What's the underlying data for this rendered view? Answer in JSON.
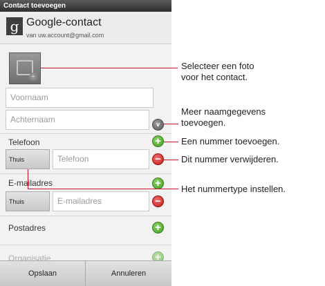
{
  "titlebar": {
    "title": "Contact toevoegen"
  },
  "account": {
    "logo": "g",
    "name": "Google-contact",
    "email": "van uw.account@gmail.com"
  },
  "photo": {
    "icon": "add-photo-icon",
    "plus": "+"
  },
  "name": {
    "first_placeholder": "Voornaam",
    "last_placeholder": "Achternaam",
    "more_icon": "v"
  },
  "phone": {
    "label": "Telefoon",
    "type": "Thuis",
    "placeholder": "Telefoon"
  },
  "email": {
    "label": "E-mailadres",
    "type": "Thuis",
    "placeholder": "E-mailadres"
  },
  "postal": {
    "label": "Postadres"
  },
  "organisation": {
    "label": "Organisatie"
  },
  "icons": {
    "add": "+",
    "remove": "−"
  },
  "bottom": {
    "save": "Opslaan",
    "cancel": "Annuleren"
  },
  "callouts": {
    "photo_line1": "Selecteer een foto",
    "photo_line2": "voor het contact.",
    "name_line1": "Meer naamgegevens",
    "name_line2": "toevoegen.",
    "add_number": "Een nummer toevoegen.",
    "remove_number": "Dit nummer verwijderen.",
    "number_type": "Het nummertype instellen."
  },
  "colors": {
    "callout": "#c8102e",
    "add": "#3f9a20",
    "remove": "#c01818"
  }
}
